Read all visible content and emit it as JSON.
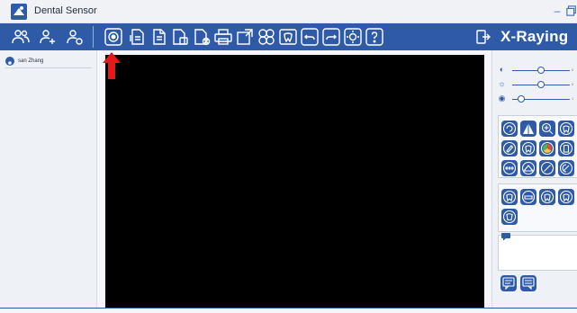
{
  "window": {
    "title": "Dental Sensor",
    "controls": [
      "minimize",
      "restore"
    ]
  },
  "toolbar": {
    "left_icons": [
      "user-group-icon",
      "add-patient-icon",
      "edit-patient-icon"
    ],
    "tool_icons": [
      "capture-icon",
      "import-icon",
      "export-icon",
      "copy-image-icon",
      "delete-image-icon",
      "print-icon",
      "fullscreen-icon",
      "layout-icon",
      "tooth-chart-icon",
      "undo-icon",
      "redo-icon",
      "settings-icon",
      "help-icon"
    ],
    "brand": "X-Raying",
    "brand_icon": "exit-icon"
  },
  "patient_list": [
    {
      "name": "san Zhang",
      "icon": "user-icon"
    }
  ],
  "sliders": [
    {
      "name": "contrast",
      "icon": "contrast-icon",
      "value": "0",
      "level": 0.5
    },
    {
      "name": "brightness",
      "icon": "brightness-icon",
      "value": "0",
      "level": 0.5
    },
    {
      "name": "gamma",
      "icon": "gamma-icon",
      "value": "1",
      "level": 0.1
    }
  ],
  "tool_grid": [
    "rotate-icon",
    "measure-angle-icon",
    "zoom-icon",
    "tooth-icon",
    "pen-icon",
    "tooth-filter-icon",
    "color-icon",
    "tooth-outline-icon",
    "ruler-icon",
    "emboss-icon",
    "line-icon",
    "negative-icon"
  ],
  "tooth_grid": [
    "tooth-a-icon",
    "tooth-b-icon",
    "tooth-c-icon",
    "tooth-d-icon",
    "tooth-e-icon"
  ],
  "comment_icon": "comment-icon",
  "bottom_buttons": [
    "note-icon",
    "report-icon"
  ],
  "colors": {
    "accent": "#2e5aa8",
    "viewer": "#000000",
    "annotation": "#e11b1b"
  }
}
